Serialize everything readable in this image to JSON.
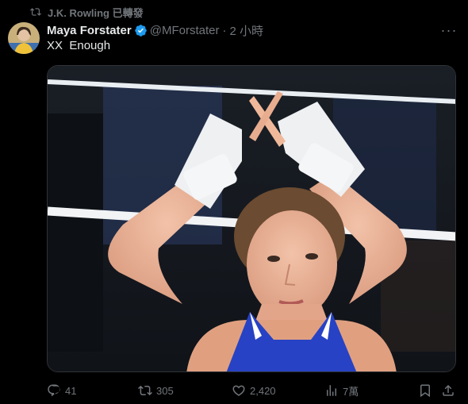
{
  "retweet": {
    "by": "J.K. Rowling",
    "label": "已轉發"
  },
  "tweet": {
    "display_name": "Maya Forstater",
    "handle": "@MForstater",
    "separator": "·",
    "time": "2 小時",
    "text": "XX  Enough"
  },
  "actions": {
    "replies": "41",
    "retweets": "305",
    "likes": "2,420",
    "views": "7萬"
  },
  "colors": {
    "background": "#000000",
    "text": "#e7e9ea",
    "muted": "#71767b",
    "verified": "#1d9bf0"
  },
  "icons": [
    "retweet-icon",
    "verified-badge-icon",
    "more-icon",
    "reply-icon",
    "like-icon",
    "views-icon",
    "bookmark-icon",
    "share-icon"
  ]
}
